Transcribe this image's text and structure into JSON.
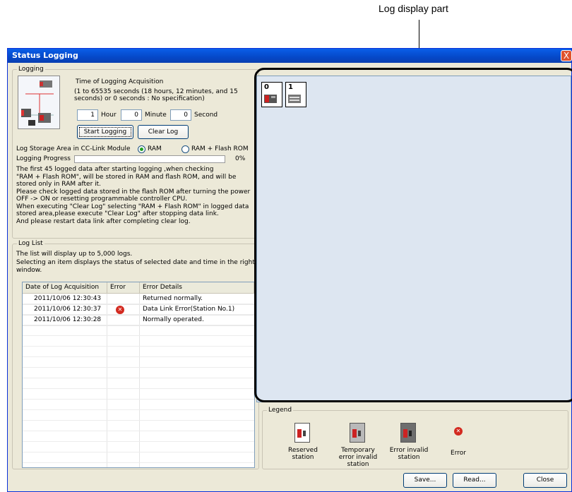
{
  "annotation": {
    "label": "Log display part"
  },
  "window": {
    "title": "Status Logging",
    "close_glyph": "X"
  },
  "logging": {
    "group_label": "Logging",
    "time_title": "Time of Logging Acquisition",
    "time_desc": "(1 to 65535 seconds (18 hours, 12 minutes, and 15 seconds) or 0 seconds : No specification)",
    "hour_value": "1",
    "hour_label": "Hour",
    "minute_value": "0",
    "minute_label": "Minute",
    "second_value": "0",
    "second_label": "Second",
    "start_button": "Start Logging",
    "clear_button": "Clear Log",
    "storage_label": "Log Storage Area in CC-Link Module",
    "radio_ram": "RAM",
    "radio_ram_flash": "RAM + Flash ROM",
    "progress_label": "Logging Progress",
    "progress_percent_text": "0%",
    "progress_fraction": 0,
    "notes": [
      "The first 45 logged data after starting logging ,when checking",
      "\"RAM + Flash ROM\", will be stored in RAM and flash ROM, and will be",
      "stored only in RAM after it.",
      "Please check logged data stored in the flash ROM after turning the power",
      "OFF -> ON or resetting  programmable controller CPU.",
      "When executing \"Clear Log\" selecting \"RAM + Flash ROM\" in logged data",
      "stored area,please execute \"Clear Log\" after stopping data link.",
      "And please restart data link after completing clear log."
    ]
  },
  "log_list": {
    "group_label": "Log List",
    "desc1": "The list will display up to 5,000 logs.",
    "desc2": "Selecting an item displays the status of selected date and time in the right window.",
    "columns": [
      "Date of Log Acquisition",
      "Error",
      "Error Details"
    ],
    "rows": [
      {
        "date": "2011/10/06 12:30:43",
        "error": false,
        "details": "Returned normally."
      },
      {
        "date": "2011/10/06 12:30:37",
        "error": true,
        "details": "Data Link Error(Station No.1)"
      },
      {
        "date": "2011/10/06 12:30:28",
        "error": false,
        "details": "Normally operated."
      }
    ]
  },
  "log_display": {
    "stations": [
      {
        "number": "0",
        "icon": "master-station-icon"
      },
      {
        "number": "1",
        "icon": "slave-station-icon"
      }
    ]
  },
  "legend": {
    "group_label": "Legend",
    "items": [
      {
        "label": "Reserved station",
        "icon": "reserved-station-icon"
      },
      {
        "label": "Temporary error invalid station",
        "icon": "temporary-error-invalid-station-icon"
      },
      {
        "label": "Error invalid station",
        "icon": "error-invalid-station-icon"
      },
      {
        "label": "Error",
        "icon": "error-icon"
      }
    ]
  },
  "buttons": {
    "save": "Save...",
    "read": "Read...",
    "close": "Close"
  },
  "colors": {
    "title_bar": "#0548c8",
    "display_bg": "#dde6f1",
    "error_red": "#d32a20"
  }
}
